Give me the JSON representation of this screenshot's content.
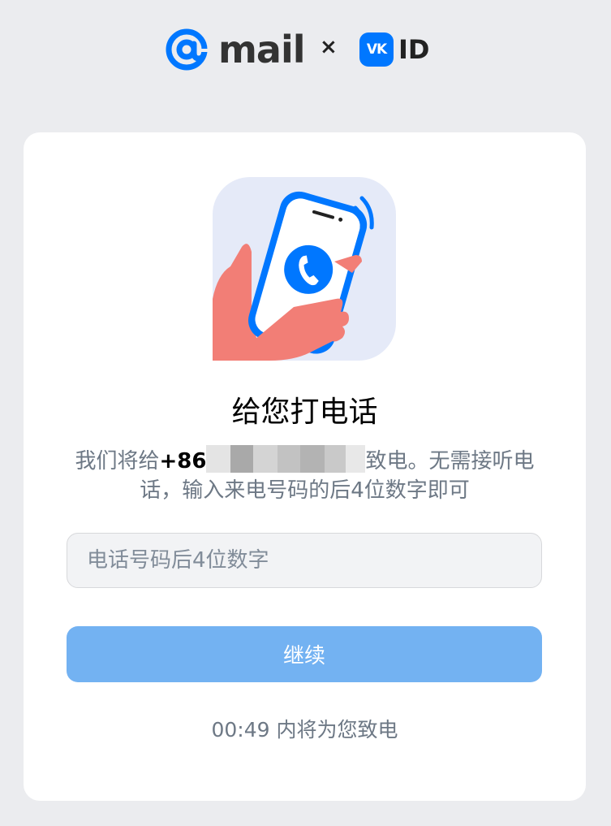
{
  "header": {
    "mail_brand": "mail",
    "separator": "×",
    "vk_badge": "VK",
    "vk_id": "ID"
  },
  "card": {
    "title": "给您打电话",
    "desc_prefix": "我们将给",
    "country_code": "+86",
    "desc_suffix": "致电。无需接听电话，输入来电号码的后4位数字即可",
    "input_placeholder": "电话号码后4位数字",
    "input_value": "",
    "continue_label": "继续",
    "countdown": "00:49 内将为您致电"
  },
  "colors": {
    "accent": "#0077ff",
    "button_disabled": "#73b2f2",
    "page_bg": "#ebecef",
    "secondary_text": "#6d7885"
  },
  "icons": [
    "mail-at-icon",
    "vk-logo-icon",
    "phone-call-illustration"
  ]
}
